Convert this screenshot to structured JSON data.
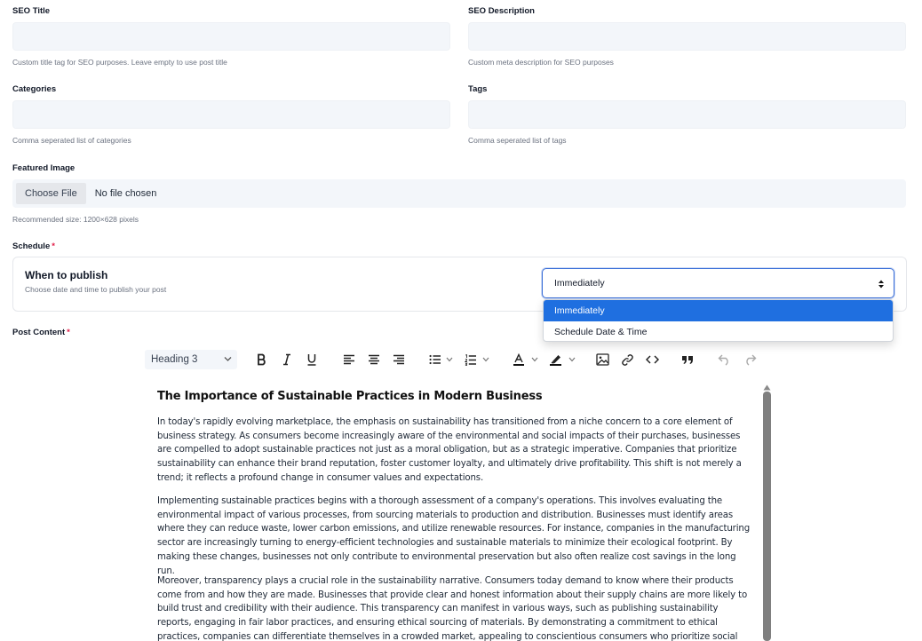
{
  "seo_title": {
    "label": "SEO Title",
    "value": "",
    "hint": "Custom title tag for SEO purposes. Leave empty to use post title"
  },
  "seo_description": {
    "label": "SEO Description",
    "value": "",
    "hint": "Custom meta description for SEO purposes"
  },
  "categories": {
    "label": "Categories",
    "value": "",
    "hint": "Comma seperated list of categories"
  },
  "tags": {
    "label": "Tags",
    "value": "",
    "hint": "Comma seperated list of tags"
  },
  "featured_image": {
    "label": "Featured Image",
    "button_label": "Choose File",
    "status": "No file chosen",
    "hint": "Recommended size: 1200×628 pixels"
  },
  "schedule": {
    "label": "Schedule",
    "required_mark": "*",
    "card_title": "When to publish",
    "card_subtitle": "Choose date and time to publish your post",
    "selected": "Immediately",
    "options": [
      "Immediately",
      "Schedule Date & Time"
    ]
  },
  "post_content": {
    "label": "Post Content",
    "required_mark": "*",
    "toolbar": {
      "heading_value": "Heading 3"
    },
    "title": "The Importance of Sustainable Practices in Modern Business",
    "paragraphs": [
      "In today's rapidly evolving marketplace, the emphasis on sustainability has transitioned from a niche concern to a core element of business strategy. As consumers become increasingly aware of the environmental and social impacts of their purchases, businesses are compelled to adopt sustainable practices not just as a moral obligation, but as a strategic imperative. Companies that prioritize sustainability can enhance their brand reputation, foster customer loyalty, and ultimately drive profitability. This shift is not merely a trend; it reflects a profound change in consumer values and expectations.",
      "Implementing sustainable practices begins with a thorough assessment of a company's operations. This involves evaluating the environmental impact of various processes, from sourcing materials to production and distribution. Businesses must identify areas where they can reduce waste, lower carbon emissions, and utilize renewable resources. For instance, companies in the manufacturing sector are increasingly turning to energy-efficient technologies and sustainable materials to minimize their ecological footprint. By making these changes, businesses not only contribute to environmental preservation but also often realize cost savings in the long run.",
      "Moreover, transparency plays a crucial role in the sustainability narrative. Consumers today demand to know where their products come from and how they are made. Businesses that provide clear and honest information about their supply chains are more likely to build trust and credibility with their audience. This transparency can manifest in various ways, such as publishing sustainability reports, engaging in fair labor practices, and ensuring ethical sourcing of materials. By demonstrating a commitment to ethical practices, companies can differentiate themselves in a crowded market, appealing to conscientious consumers who prioritize social responsibility."
    ]
  },
  "colors": {
    "accent": "#1f6fe0",
    "required": "#e11d48",
    "input_bg": "#f3f6fa"
  }
}
